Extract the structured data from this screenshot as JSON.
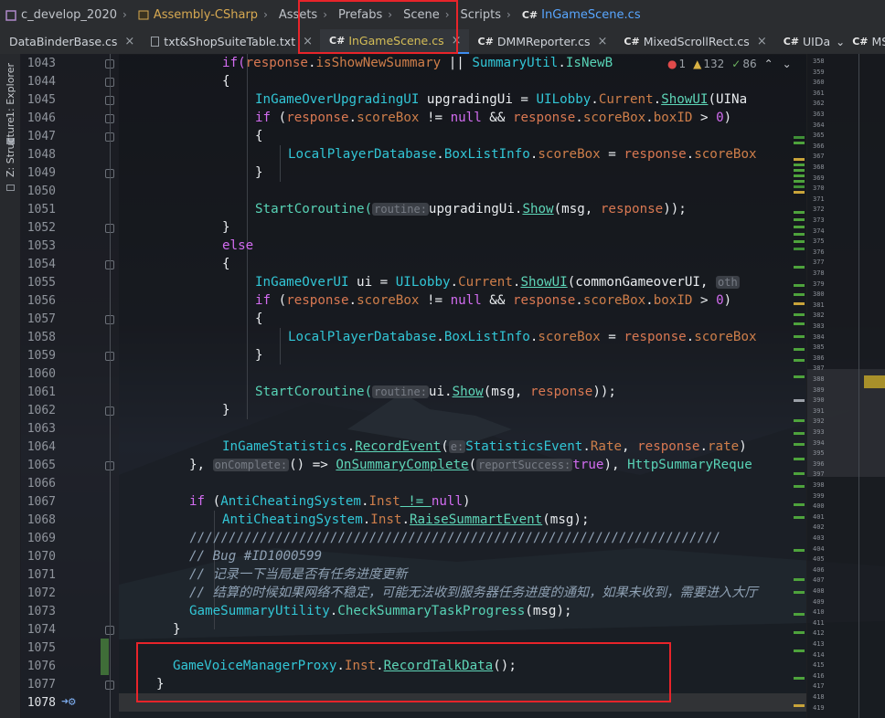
{
  "breadcrumb": {
    "items": [
      {
        "label": "c_develop_2020",
        "kind": "proj",
        "icon": "project-icon"
      },
      {
        "label": "Assembly-CSharp",
        "kind": "asm",
        "icon": "csharp-project-icon"
      },
      {
        "label": "Assets",
        "kind": "plain"
      },
      {
        "label": "Prefabs",
        "kind": "plain"
      },
      {
        "label": "Scene",
        "kind": "plain"
      },
      {
        "label": "Scripts",
        "kind": "plain"
      },
      {
        "label": "InGameScene.cs",
        "kind": "file",
        "icon": "csharp-file-icon"
      }
    ]
  },
  "tabs": {
    "items": [
      {
        "label": "DataBinderBase.cs",
        "prefix": "",
        "active": false
      },
      {
        "label": "txt&ShopSuiteTable.txt",
        "prefix": "",
        "active": false
      },
      {
        "label": "InGameScene.cs",
        "prefix": "C#",
        "active": true
      },
      {
        "label": "DMMReporter.cs",
        "prefix": "C#",
        "active": false
      },
      {
        "label": "MixedScrollRect.cs",
        "prefix": "C#",
        "active": false
      },
      {
        "label": "UIDa",
        "prefix": "C#",
        "active": false
      },
      {
        "label": "MStatUtil.cs",
        "prefix": "C#",
        "active": false
      }
    ],
    "overflow_icon": "chevron-down-icon"
  },
  "tool_strip": {
    "explorer": "1: Explorer",
    "structure": "Z: Structure"
  },
  "inspection": {
    "errors": "1",
    "warnings": "132",
    "ok": "86"
  },
  "gutter": {
    "line_numbers": [
      "1043",
      "1044",
      "1045",
      "1046",
      "1047",
      "1048",
      "1049",
      "1050",
      "1051",
      "1052",
      "1053",
      "1054",
      "1055",
      "1056",
      "1057",
      "1058",
      "1059",
      "1060",
      "1061",
      "1062",
      "1063",
      "1064",
      "1065",
      "1066",
      "1067",
      "1068",
      "1069",
      "1070",
      "1071",
      "1072",
      "1073",
      "1074",
      "1075",
      "1076",
      "1077",
      "1078"
    ]
  },
  "code": {
    "l1043": [
      "if(",
      "response",
      ".",
      "isShowNewSummary",
      " || ",
      "SummaryUtil",
      ".",
      "IsNewB"
    ],
    "l1044": "{",
    "l1045": [
      "InGameOverUpgradingUI",
      " upgradingUi = ",
      "UILobby",
      ".",
      "Current",
      ".",
      "ShowUI",
      "(UINa"
    ],
    "l1046": [
      "if",
      " (",
      "response",
      ".",
      "scoreBox",
      " != ",
      "null",
      " && ",
      "response",
      ".",
      "scoreBox",
      ".",
      "boxID",
      " > ",
      "0",
      ")"
    ],
    "l1047": "{",
    "l1048": [
      "LocalPlayerDatabase",
      ".",
      "BoxListInfo",
      ".",
      "scoreBox",
      " = ",
      "response",
      ".",
      "scoreBox"
    ],
    "l1049": "}",
    "l1051": [
      "StartCoroutine(",
      "routine:",
      "upgradingUi",
      ".",
      "Show",
      "(msg, ",
      "response",
      "));"
    ],
    "l1052": "}",
    "l1053": "else",
    "l1054": "{",
    "l1055": [
      "InGameOverUI",
      " ui = ",
      "UILobby",
      ".",
      "Current",
      ".",
      "ShowUI",
      "(",
      "commonGameoverUI",
      ", ",
      "oth"
    ],
    "l1056": [
      "if",
      " (",
      "response",
      ".",
      "scoreBox",
      " != ",
      "null",
      " && ",
      "response",
      ".",
      "scoreBox",
      ".",
      "boxID",
      " > ",
      "0",
      ")"
    ],
    "l1057": "{",
    "l1058": [
      "LocalPlayerDatabase",
      ".",
      "BoxListInfo",
      ".",
      "scoreBox",
      " = ",
      "response",
      ".",
      "scoreBox"
    ],
    "l1059": "}",
    "l1061": [
      "StartCoroutine(",
      "routine:",
      "ui",
      ".",
      "Show",
      "(msg, ",
      "response",
      "));"
    ],
    "l1062": "}",
    "l1064": [
      "InGameStatistics",
      ".",
      "RecordEvent",
      "(",
      "e:",
      "StatisticsEvent",
      ".",
      "Rate",
      ", ",
      "response",
      ".",
      "rate",
      ")"
    ],
    "l1065": [
      "}, ",
      "onComplete:",
      "() => ",
      "OnSummaryComplete",
      "(",
      "reportSuccess:",
      "true",
      "), ",
      "HttpSummaryReque"
    ],
    "l1067": [
      "if",
      " (",
      "AntiCheatingSystem",
      ".",
      "Inst",
      " != ",
      "null",
      ")"
    ],
    "l1068": [
      "AntiCheatingSystem",
      ".",
      "Inst",
      ".",
      "RaiseSummartEvent",
      "(msg);"
    ],
    "l1069": "////////////////////////////////////////////////////////////////////",
    "l1070": "// Bug #ID1000599",
    "l1071": "// 记录一下当局是否有任务进度更新",
    "l1072": "// 结算的时候如果网络不稳定，可能无法收到服务器任务进度的通知，如果未收到，需要进入大厅",
    "l1073": [
      "GameSummaryUtility",
      ".",
      "CheckSummaryTaskProgress",
      "(msg);"
    ],
    "l1074": "}",
    "l1076": [
      "GameVoiceManagerProxy",
      ".",
      "Inst",
      ".",
      "RecordTalkData",
      "();"
    ],
    "l1077": "}"
  },
  "minimap": {
    "numbers": [
      "358",
      "359",
      "360",
      "361",
      "362",
      "363",
      "364",
      "365",
      "366",
      "367",
      "368",
      "369",
      "370",
      "371",
      "372",
      "373",
      "374",
      "375",
      "376",
      "377",
      "378",
      "379",
      "380",
      "381",
      "382",
      "383",
      "384",
      "385",
      "386",
      "387",
      "388",
      "389",
      "390",
      "391",
      "392",
      "393",
      "394",
      "395",
      "396",
      "397",
      "398",
      "399",
      "400",
      "401",
      "402",
      "403",
      "404",
      "405",
      "406",
      "407",
      "408",
      "409",
      "410",
      "411",
      "412",
      "413",
      "414",
      "415",
      "416",
      "417",
      "418",
      "419"
    ]
  },
  "colors": {
    "annotation": "#e8242a",
    "keyword": "#d26cf0",
    "type": "#32c6d6",
    "method": "#58d3b6",
    "property": "#ce7e4a"
  }
}
